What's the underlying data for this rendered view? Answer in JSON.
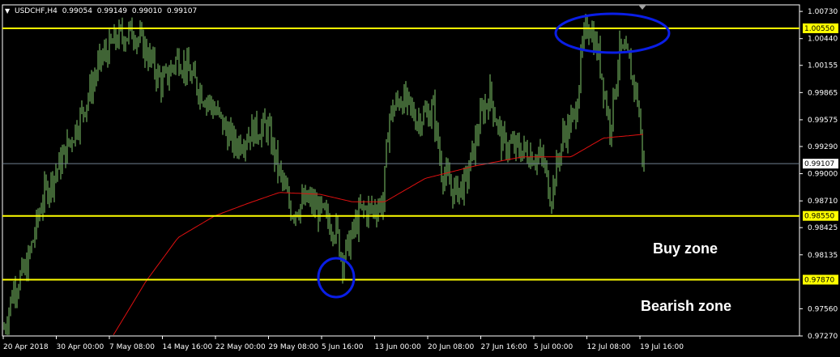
{
  "header": {
    "symbol": "USDCHF,H4",
    "open": "0.99054",
    "high": "0.99149",
    "low": "0.99010",
    "close": "0.99107"
  },
  "chart_data": {
    "type": "bar",
    "symbol": "USDCHF",
    "timeframe": "H4",
    "ylim": [
      0.9727,
      1.008
    ],
    "y_ticks": [
      "1.00730",
      "1.00440",
      "1.00155",
      "0.99865",
      "0.99575",
      "0.99290",
      "0.99000",
      "0.98710",
      "0.98425",
      "0.98135",
      "0.97560",
      "0.97270"
    ],
    "x_ticks": [
      "20 Apr 2018",
      "30 Apr 00:00",
      "7 May 08:00",
      "14 May 16:00",
      "22 May 00:00",
      "29 May 08:00",
      "5 Jun 16:00",
      "13 Jun 00:00",
      "20 Jun 08:00",
      "27 Jun 16:00",
      "5 Jul 00:00",
      "12 Jul 08:00",
      "19 Jul 16:00"
    ],
    "price_anchors": [
      [
        0,
        0.9735
      ],
      [
        12,
        0.9778
      ],
      [
        28,
        0.98
      ],
      [
        48,
        0.9875
      ],
      [
        70,
        0.9912
      ],
      [
        95,
        0.9962
      ],
      [
        120,
        1.0022
      ],
      [
        140,
        1.0045
      ],
      [
        160,
        1.0052
      ],
      [
        175,
        1.0032
      ],
      [
        195,
        0.9995
      ],
      [
        215,
        1.0025
      ],
      [
        235,
        0.9998
      ],
      [
        260,
        0.9968
      ],
      [
        285,
        0.993
      ],
      [
        305,
        0.9945
      ],
      [
        325,
        0.995
      ],
      [
        340,
        0.99
      ],
      [
        355,
        0.986
      ],
      [
        375,
        0.9872
      ],
      [
        395,
        0.9855
      ],
      [
        410,
        0.984
      ],
      [
        418,
        0.9808
      ],
      [
        428,
        0.983
      ],
      [
        440,
        0.986
      ],
      [
        455,
        0.9862
      ],
      [
        468,
        0.987
      ],
      [
        475,
        0.996
      ],
      [
        490,
        0.9982
      ],
      [
        510,
        0.9958
      ],
      [
        530,
        0.9968
      ],
      [
        540,
        0.9905
      ],
      [
        555,
        0.988
      ],
      [
        570,
        0.989
      ],
      [
        590,
        0.9965
      ],
      [
        600,
        0.9985
      ],
      [
        615,
        0.9932
      ],
      [
        640,
        0.9925
      ],
      [
        665,
        0.9915
      ],
      [
        675,
        0.9875
      ],
      [
        690,
        0.994
      ],
      [
        705,
        0.9962
      ],
      [
        715,
        1.004
      ],
      [
        722,
        1.0062
      ],
      [
        735,
        1.0022
      ],
      [
        748,
        0.995
      ],
      [
        760,
        1.003
      ],
      [
        770,
        1.0022
      ],
      [
        782,
        0.998
      ],
      [
        790,
        0.9905
      ]
    ],
    "ma_anchors": [
      [
        135,
        0.9728
      ],
      [
        175,
        0.9785
      ],
      [
        215,
        0.9832
      ],
      [
        260,
        0.9855
      ],
      [
        300,
        0.9868
      ],
      [
        340,
        0.988
      ],
      [
        390,
        0.9878
      ],
      [
        430,
        0.987
      ],
      [
        470,
        0.987
      ],
      [
        520,
        0.9895
      ],
      [
        580,
        0.9908
      ],
      [
        640,
        0.9918
      ],
      [
        700,
        0.9918
      ],
      [
        740,
        0.9938
      ],
      [
        790,
        0.9942
      ]
    ],
    "levels": [
      {
        "value": "1.00550",
        "line_color": "#ffff00",
        "box_bg": "#ffff00",
        "box_fg": "#000000"
      },
      {
        "value": "0.98550",
        "line_color": "#ffff00",
        "box_bg": "#ffff00",
        "box_fg": "#000000"
      },
      {
        "value": "0.97870",
        "line_color": "#ffff00",
        "box_bg": "#ffff00",
        "box_fg": "#000000"
      },
      {
        "value": "0.99107",
        "line_color": "#708090",
        "box_bg": "#ffffff",
        "box_fg": "#000000"
      }
    ],
    "annotations": {
      "buy_zone": "Buy zone",
      "bearish_zone": "Bearish zone"
    },
    "colors": {
      "bars": "#7fc96a",
      "ma": "#e01010",
      "highlight_circles": "#0a1ee6",
      "grid_frame": "#ffffff"
    },
    "grid": false
  }
}
